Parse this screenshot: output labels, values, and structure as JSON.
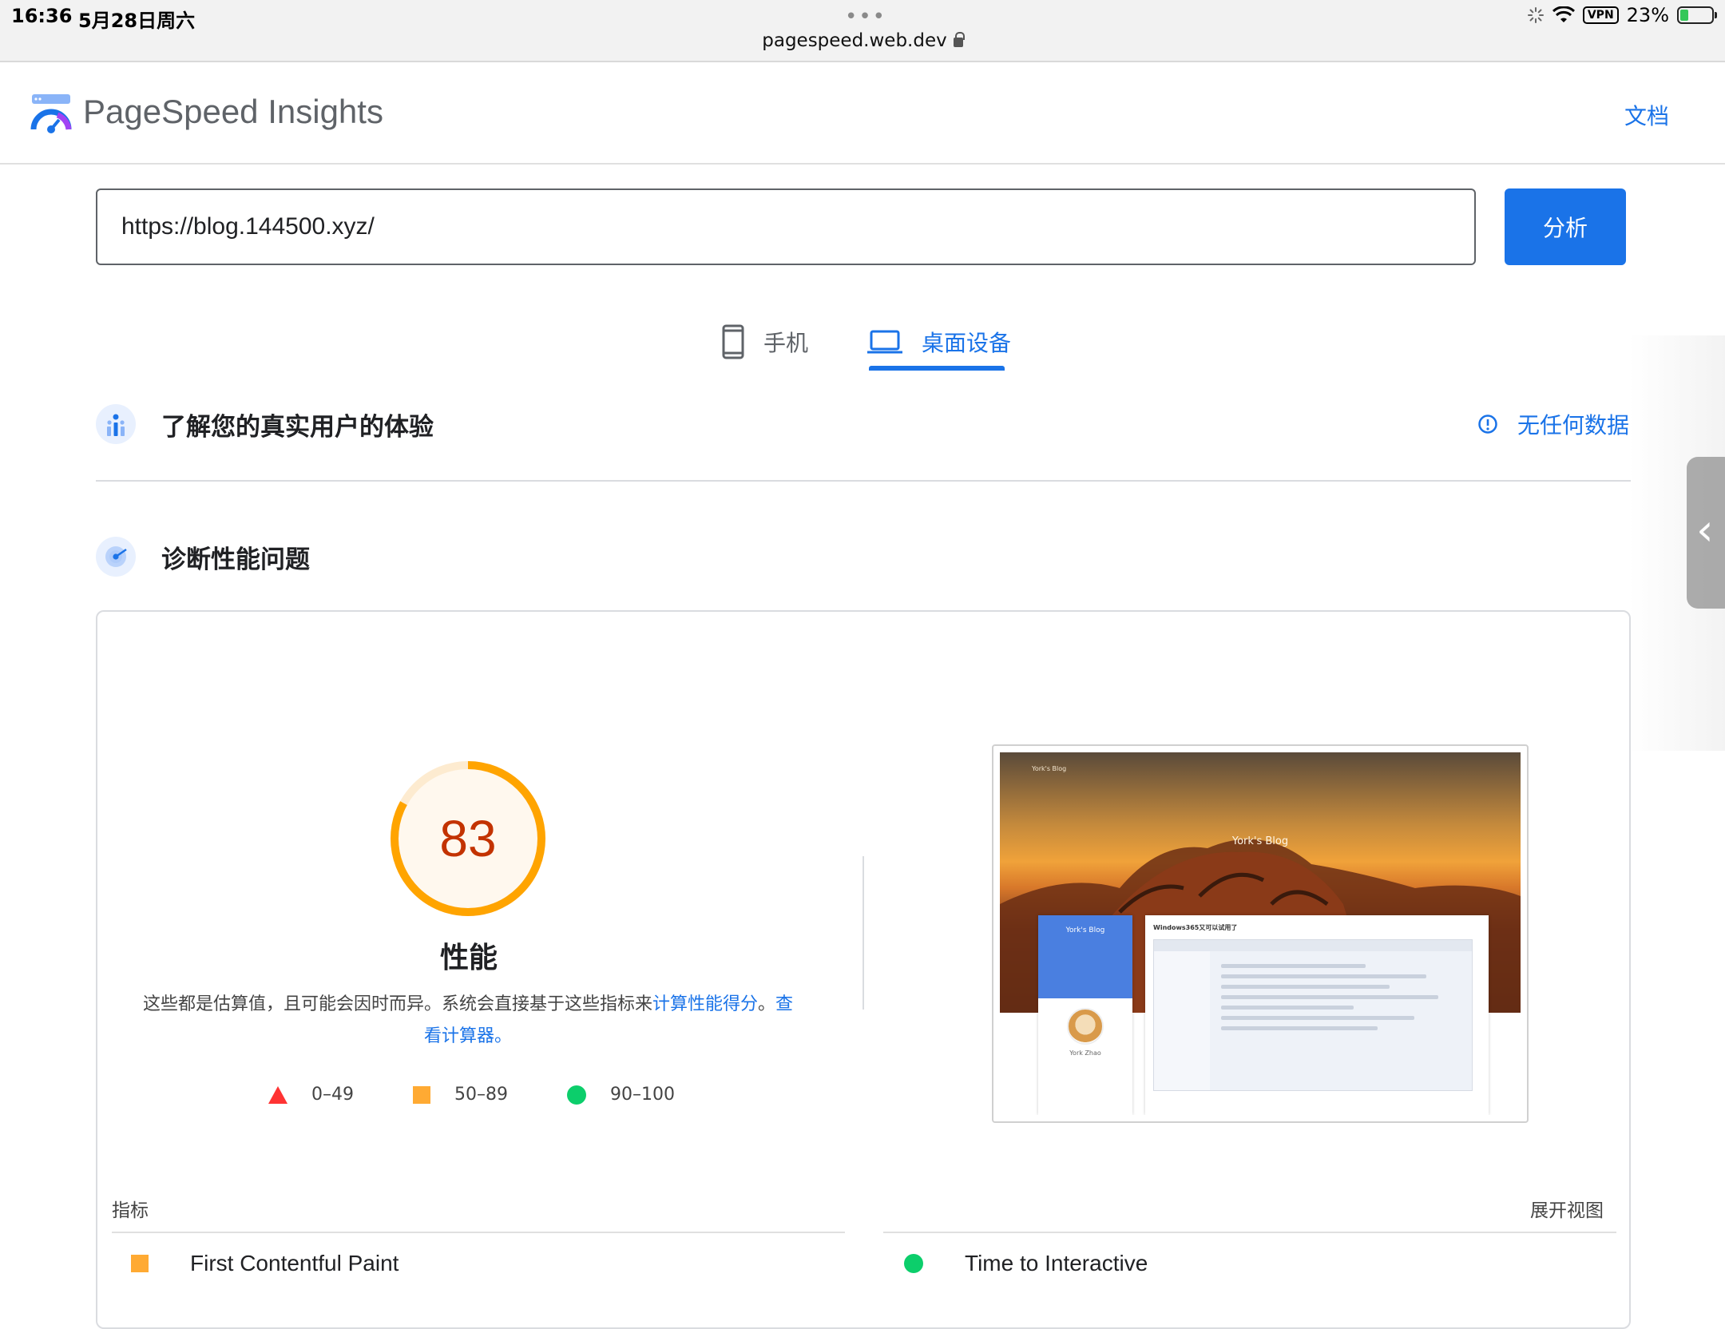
{
  "statusbar": {
    "time": "16:36",
    "date": "5月28日周六",
    "dots": "•••",
    "url": "pagespeed.web.dev",
    "vpn": "VPN",
    "battery": "23%"
  },
  "header": {
    "brand": "PageSpeed Insights",
    "docs_link": "文档"
  },
  "search": {
    "url_value": "https://blog.144500.xyz/",
    "analyze_label": "分析"
  },
  "tabs": [
    {
      "label": "手机",
      "icon": "phone-icon",
      "active": false
    },
    {
      "label": "桌面设备",
      "icon": "laptop-icon",
      "active": true
    }
  ],
  "ux_section": {
    "title": "了解您的真实用户的体验",
    "no_data": "无任何数据"
  },
  "diag_section": {
    "title": "诊断性能问题"
  },
  "performance": {
    "score": "83",
    "score_color": "#c33300",
    "gauge_color": "#ffa400",
    "title": "性能",
    "desc_text": "这些都是估算值，且可能会因时而异。系统会直接基于这些指标来",
    "desc_link1": "计算性能得分",
    "desc_sep": "。",
    "desc_link2": "查看计算器。",
    "legend": [
      {
        "range": "0–49",
        "color": "#ff3333",
        "shape": "triangle"
      },
      {
        "range": "50–89",
        "color": "#ffaa33",
        "shape": "square"
      },
      {
        "range": "90–100",
        "color": "#0cce6b",
        "shape": "circle"
      }
    ]
  },
  "screenshot": {
    "hero_title": "York's Blog",
    "profile_title": "York's Blog",
    "profile_name": "York Zhao",
    "post_title": "Windows365又可以试用了"
  },
  "metrics": {
    "label": "指标",
    "expand": "展开视图",
    "items": [
      {
        "name": "First Contentful Paint",
        "status": "average"
      },
      {
        "name": "Time to Interactive",
        "status": "good"
      }
    ]
  }
}
